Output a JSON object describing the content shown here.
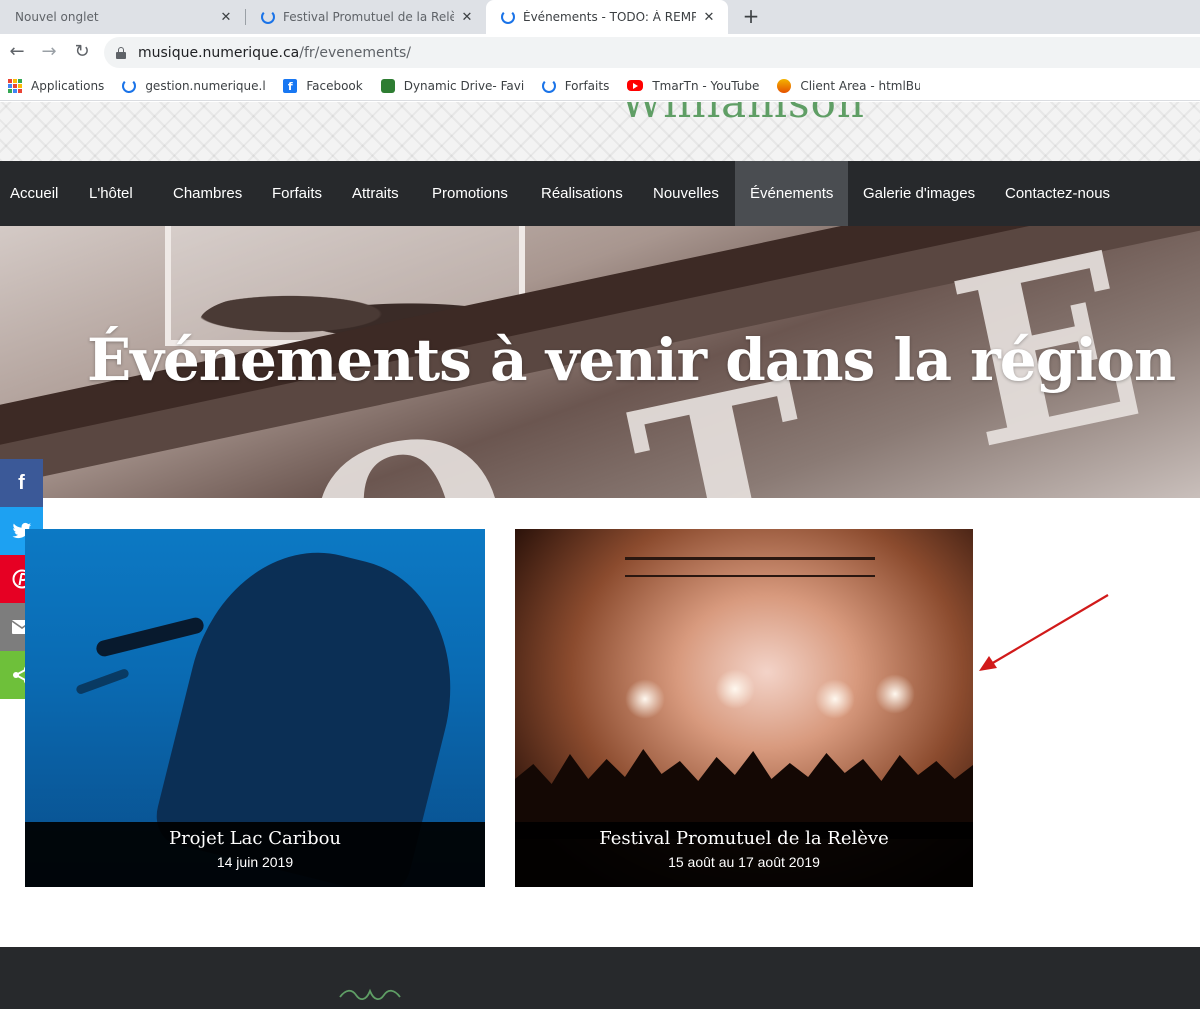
{
  "browser": {
    "tabs": [
      {
        "title": "Nouvel onglet",
        "close": "✕"
      },
      {
        "title": "Festival Promutuel de la Relève -",
        "close": "✕"
      },
      {
        "title": "Événements - TODO: À REMPLAC",
        "close": "✕"
      }
    ],
    "new_tab": "+",
    "url_host": "musique.numerique.ca",
    "url_path": "/fr/evenements/",
    "bookmarks": [
      {
        "label": "Applications"
      },
      {
        "label": "gestion.numerique.lo"
      },
      {
        "label": "Facebook"
      },
      {
        "label": "Dynamic Drive- Favic"
      },
      {
        "label": "Forfaits"
      },
      {
        "label": "TmarTn - YouTube"
      },
      {
        "label": "Client Area - htmlBur"
      }
    ]
  },
  "site": {
    "logo_text": "Williamson",
    "nav": [
      {
        "label": "Accueil"
      },
      {
        "label": "L'hôtel"
      },
      {
        "label": "Chambres"
      },
      {
        "label": "Forfaits"
      },
      {
        "label": "Attraits"
      },
      {
        "label": "Promotions"
      },
      {
        "label": "Réalisations"
      },
      {
        "label": "Nouvelles"
      },
      {
        "label": "Événements"
      },
      {
        "label": "Galerie d'images"
      },
      {
        "label": "Contactez-nous"
      }
    ],
    "active_nav": "Événements",
    "hero_title": "Événements à venir dans la région",
    "social": [
      {
        "icon": "facebook-icon",
        "glyph": "f",
        "color": "#3b5998"
      },
      {
        "icon": "twitter-icon",
        "glyph": "t",
        "color": "#1da1f2"
      },
      {
        "icon": "pinterest-icon",
        "glyph": "P",
        "color": "#e60023"
      },
      {
        "icon": "email-icon",
        "glyph": "✉",
        "color": "#7d7d7d"
      },
      {
        "icon": "share-icon",
        "glyph": "<",
        "color": "#6ec03a"
      }
    ],
    "events": [
      {
        "title": "Projet Lac Caribou",
        "date": "14 juin 2019"
      },
      {
        "title": "Festival Promutuel de la Relève",
        "date": "15 août au 17 août 2019"
      }
    ]
  },
  "colors": {
    "nav_bg": "#27292c",
    "nav_active": "#4a4d51",
    "logo_green": "#5f9e65",
    "annotation_arrow": "#d11a1a"
  }
}
